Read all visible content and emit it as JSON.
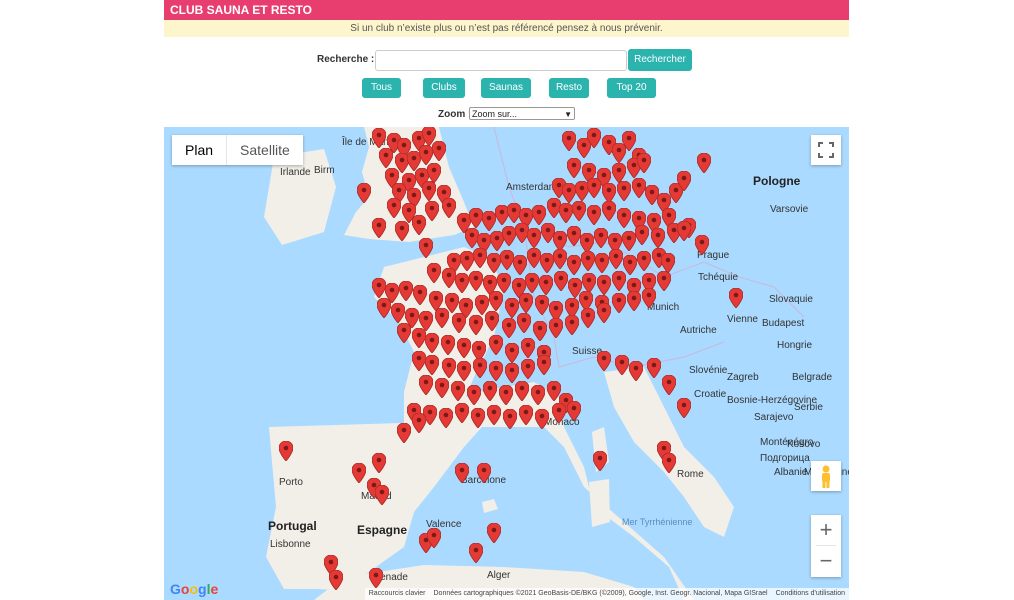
{
  "header": {
    "title": "CLUB SAUNA ET RESTO"
  },
  "notice": {
    "text": "Si un club n’existe plus ou n’est pas référencé pensez à nous prévenir."
  },
  "search": {
    "label": "Recherche :",
    "value": "",
    "placeholder": "",
    "button": "Rechercher"
  },
  "filters": [
    "Tous",
    "Clubs",
    "Saunas",
    "Resto",
    "Top 20"
  ],
  "zoom": {
    "label": "Zoom :",
    "selected": "Zoom sur..."
  },
  "map": {
    "map_type": {
      "plan": "Plan",
      "satellite": "Satellite"
    },
    "labels": {
      "ile_de_man": "Île de Man",
      "birmingham": "Birm",
      "irlande": "Irlande",
      "amsterdam": "Amsterdam",
      "pologne": "Pologne",
      "varsovie": "Varsovie",
      "prague": "Prague",
      "tcheque": "Tchéquie",
      "slovaquie": "Slovaquie",
      "vienne": "Vienne",
      "munich": "Munich",
      "autriche": "Autriche",
      "budapest": "Budapest",
      "hongrie": "Hongrie",
      "suisse": "Suisse",
      "slovenie": "Slovénie",
      "zagreb": "Zagreb",
      "croatie": "Croatie",
      "bosnie": "Bosnie-Herzégovine",
      "sarajevo": "Sarajevo",
      "serbie": "Serbie",
      "belgrade": "Belgrade",
      "montenegro": "Monténégro",
      "kosovo": "Kosovo",
      "albanie": "Albanie",
      "macedoine": "Macédoine",
      "podgorica": "Подгорица",
      "rome": "Rome",
      "mer_tyrrhenienne": "Mer Tyrrhénienne",
      "porto": "Porto",
      "portugal": "Portugal",
      "espagne": "Espagne",
      "madrid": "Madrid",
      "valence": "Valence",
      "barcelone": "Barcelone",
      "lisbonne": "Lisbonne",
      "grenade": "Grenade",
      "alger": "Alger",
      "monaco": "Monaco"
    },
    "marker_icon": "map-pin-icon",
    "marker_color": "#e53935",
    "footer": {
      "shortcuts": "Raccourcis clavier",
      "data": "Données cartographiques ©2021 GeoBasis-DE/BKG (©2009), Google, Inst. Geogr. Nacional, Mapa GISrael",
      "terms": "Conditions d'utilisation"
    },
    "logo": "Google"
  },
  "colors": {
    "header": "#e83d6f",
    "notice_bg": "#fdf5cc",
    "button": "#2bb3ae",
    "sea": "#aadaff",
    "land": "#f2efe9"
  }
}
